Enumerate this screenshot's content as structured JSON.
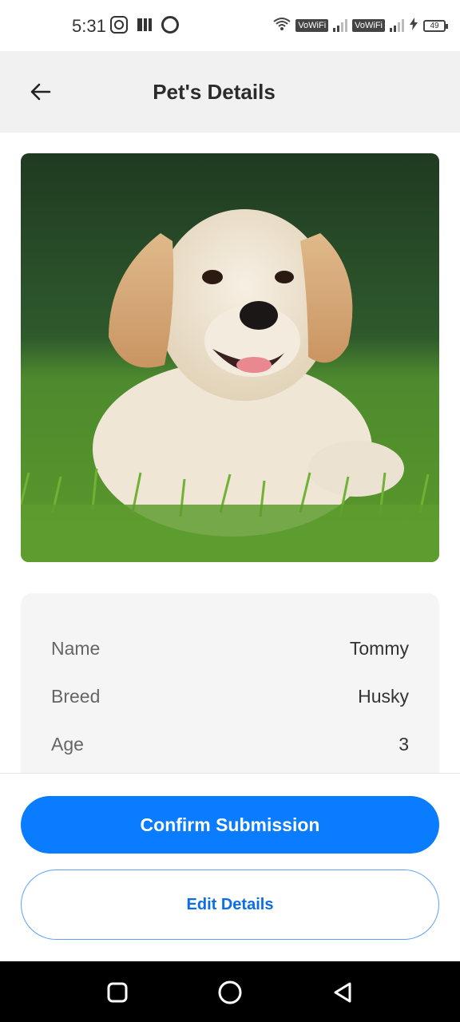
{
  "status_bar": {
    "time": "5:31",
    "vowifi_1": "VoWiFi",
    "vowifi_2": "VoWiFi",
    "battery": "49"
  },
  "header": {
    "title": "Pet's Details",
    "back_icon": "arrow-left-icon"
  },
  "pet": {
    "photo_alt": "puppy",
    "details": [
      {
        "label": "Name",
        "value": "Tommy"
      },
      {
        "label": "Breed",
        "value": "Husky"
      },
      {
        "label": "Age",
        "value": "3"
      }
    ]
  },
  "actions": {
    "confirm_label": "Confirm Submission",
    "edit_label": "Edit Details"
  },
  "colors": {
    "primary": "#0a7cff",
    "outline": "#5aa0ff"
  }
}
